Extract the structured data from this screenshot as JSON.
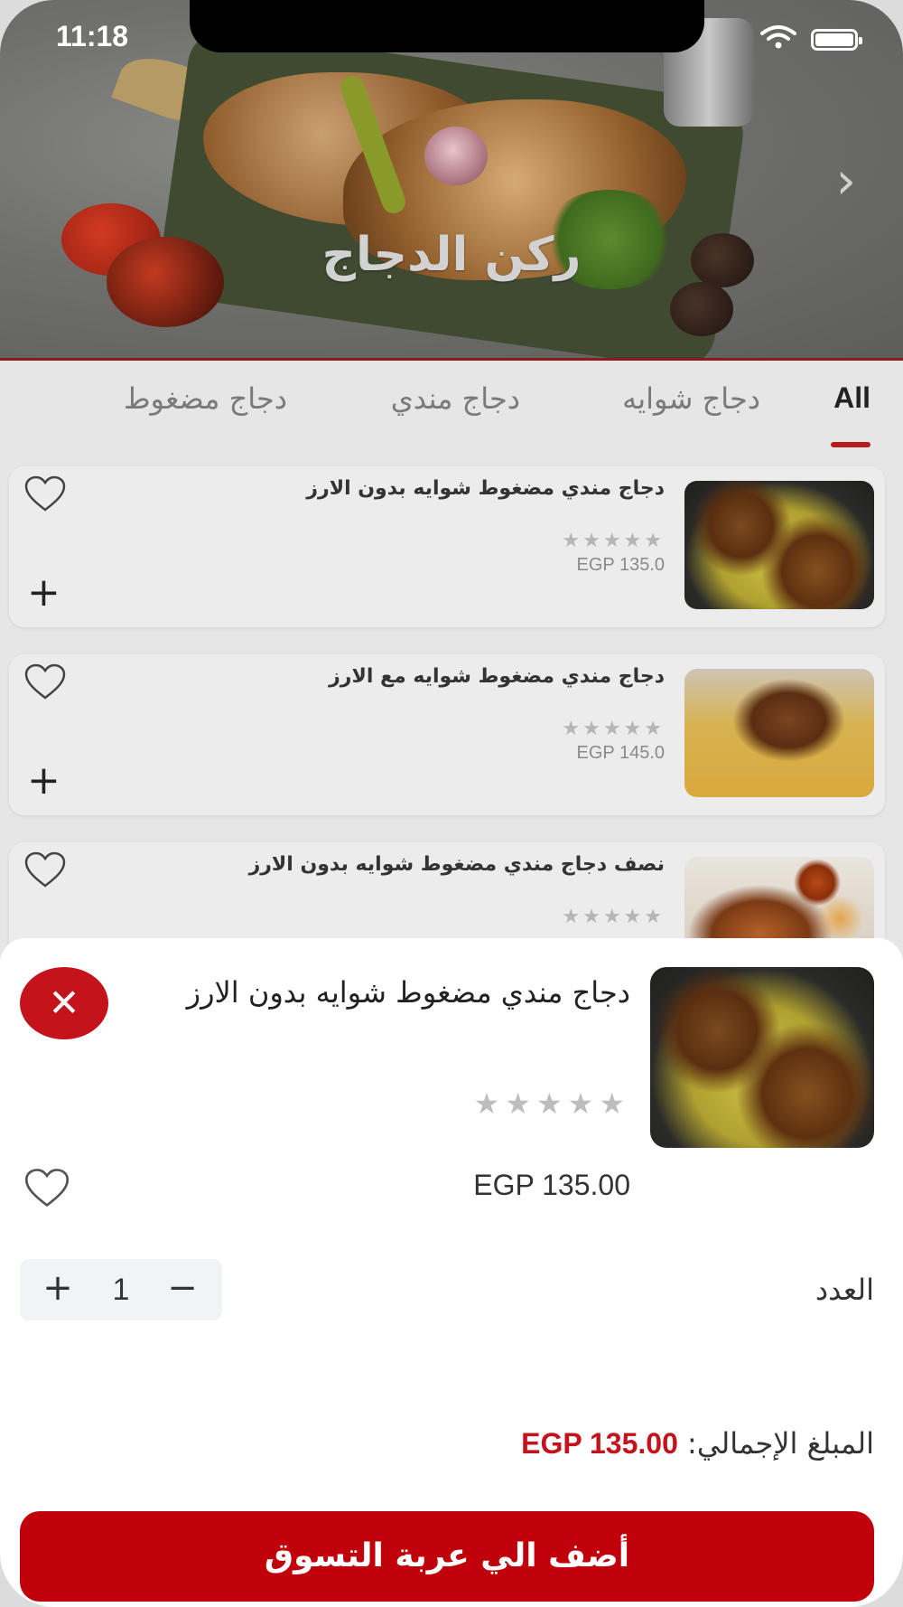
{
  "status": {
    "time": "11:18"
  },
  "hero": {
    "title": "ركن الدجاج",
    "next_icon": "chevron-right-icon"
  },
  "tabs": [
    {
      "label": "All",
      "active": true
    },
    {
      "label": "دجاج شوايه",
      "active": false
    },
    {
      "label": "دجاج مندي",
      "active": false
    },
    {
      "label": "دجاج مضغوط",
      "active": false
    }
  ],
  "items": [
    {
      "name": "دجاج مندي مضغوط شوايه بدون الارز",
      "rating_stars": "★★★★★",
      "price": "EGP 135.0"
    },
    {
      "name": "دجاج مندي مضغوط شوايه مع الارز",
      "rating_stars": "★★★★★",
      "price": "EGP 145.0"
    },
    {
      "name": "نصف دجاج مندي مضغوط شوايه بدون الارز",
      "rating_stars": "★★★★★",
      "price": ""
    }
  ],
  "sheet": {
    "title": "دجاج مندي مضغوط شوايه بدون الارز",
    "rating_stars": "★★★★★",
    "price": "EGP 135.00",
    "quantity_label": "العدد",
    "quantity_value": "1",
    "total_label": "المبلغ الإجمالي:",
    "total_amount": "EGP 135.00",
    "add_to_cart_label": "أضف الي عربة التسوق"
  },
  "colors": {
    "accent": "#c4131a",
    "cta": "#c0000a"
  }
}
